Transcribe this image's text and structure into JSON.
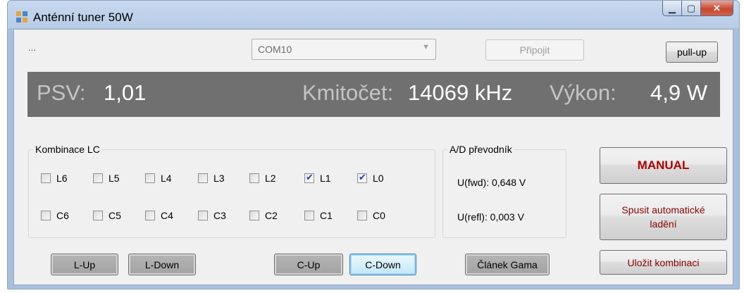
{
  "window": {
    "title": "Anténní tuner 50W"
  },
  "status": {
    "text": "..."
  },
  "port": {
    "selected": "COM10"
  },
  "buttons": {
    "connect": "Připojit",
    "pullup": "pull-up",
    "manual": "MANUAL",
    "auto_tune": "Spusit automatické ladění",
    "save_combo": "Uložit kombinaci",
    "gamma": "Článek Gama",
    "l_up": "L-Up",
    "l_down": "L-Down",
    "c_up": "C-Up",
    "c_down": "C-Down"
  },
  "readout": {
    "psv_label": "PSV:",
    "psv_value": "1,01",
    "freq_label": "Kmitočet:",
    "freq_value": "14069 kHz",
    "power_label": "Výkon:",
    "power_value": "4,9 W"
  },
  "lc_group": {
    "title": "Kombinace LC",
    "inductors": [
      {
        "label": "L6",
        "checked": false
      },
      {
        "label": "L5",
        "checked": false
      },
      {
        "label": "L4",
        "checked": false
      },
      {
        "label": "L3",
        "checked": false
      },
      {
        "label": "L2",
        "checked": false
      },
      {
        "label": "L1",
        "checked": true
      },
      {
        "label": "L0",
        "checked": true
      }
    ],
    "capacitors": [
      {
        "label": "C6",
        "checked": false
      },
      {
        "label": "C5",
        "checked": false
      },
      {
        "label": "C4",
        "checked": false
      },
      {
        "label": "C3",
        "checked": false
      },
      {
        "label": "C2",
        "checked": false
      },
      {
        "label": "C1",
        "checked": false
      },
      {
        "label": "C0",
        "checked": false
      }
    ]
  },
  "ad_group": {
    "title": "A/D převodník",
    "fwd": "U(fwd): 0,648 V",
    "refl": "U(refl): 0,003 V"
  },
  "colors": {
    "panel_bg": "#707070",
    "manual_text": "#b00000",
    "auto_text": "#8b0000"
  }
}
